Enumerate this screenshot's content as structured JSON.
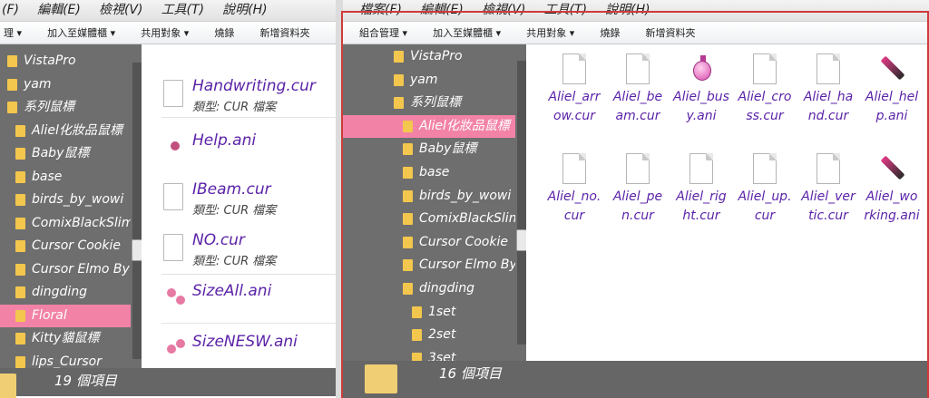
{
  "left": {
    "menu": [
      "(F)",
      "編輯(E)",
      "檢視(V)",
      "工具(T)",
      "說明(H)"
    ],
    "toolbar": [
      "理 ▾",
      "加入至媒體櫃 ▾",
      "共用對象 ▾",
      "燒錄",
      "新增資料夾"
    ],
    "nav": [
      "VistaPro",
      "yam",
      "系列鼠標",
      "Aliel化妝品鼠標",
      "Baby鼠標",
      "base",
      "birds_by_wowi",
      "ComixBlackSlim",
      "Cursor Cookie",
      "Cursor Elmo By",
      "dingding",
      "Floral",
      "Kitty貓鼠標",
      "lips_Cursor"
    ],
    "selected": "Floral",
    "files": [
      {
        "name": "Handwriting.cur",
        "type": "類型: CUR 檔案",
        "icon": "doc-icon"
      },
      {
        "name": "Help.ani",
        "type": "",
        "icon": "flower-cursor-icon"
      },
      {
        "name": "IBeam.cur",
        "type": "類型: CUR 檔案",
        "icon": "doc-icon"
      },
      {
        "name": "NO.cur",
        "type": "類型: CUR 檔案",
        "icon": "doc-icon"
      },
      {
        "name": "SizeAll.ani",
        "type": "",
        "icon": "flower-cursor-icon"
      },
      {
        "name": "SizeNESW.ani",
        "type": "",
        "icon": "flower-cursor-icon"
      }
    ],
    "status": "19 個項目"
  },
  "right": {
    "menu": [
      "檔案(F)",
      "編輯(E)",
      "檢視(V)",
      "工具(T)",
      "說明(H)"
    ],
    "toolbar": [
      "組合管理 ▾",
      "加入至媒體櫃 ▾",
      "共用對象 ▾",
      "燒錄",
      "新增資料夾"
    ],
    "nav": [
      "VistaPro",
      "yam",
      "系列鼠標",
      "Aliel化妝品鼠標",
      "Baby鼠標",
      "base",
      "birds_by_wowi",
      "ComixBlackSlim",
      "Cursor Cookie",
      "Cursor Elmo By",
      "dingding",
      "1set",
      "2set",
      "3set"
    ],
    "selected": "Aliel化妝品鼠標",
    "files": [
      {
        "name": "Aliel_arrow.cur",
        "icon": "doc-icon"
      },
      {
        "name": "Aliel_beam.cur",
        "icon": "doc-icon"
      },
      {
        "name": "Aliel_busy.ani",
        "icon": "perfume-bottle-icon"
      },
      {
        "name": "Aliel_cross.cur",
        "icon": "doc-icon"
      },
      {
        "name": "Aliel_hand.cur",
        "icon": "doc-icon"
      },
      {
        "name": "Aliel_help.ani",
        "icon": "lipstick-icon"
      },
      {
        "name": "Aliel_no.cur",
        "icon": "doc-icon"
      },
      {
        "name": "Aliel_pen.cur",
        "icon": "doc-icon"
      },
      {
        "name": "Aliel_right.cur",
        "icon": "doc-icon"
      },
      {
        "name": "Aliel_up.cur",
        "icon": "doc-icon"
      },
      {
        "name": "Aliel_vertic.cur",
        "icon": "doc-icon"
      },
      {
        "name": "Aliel_working.ani",
        "icon": "lipstick-icon"
      }
    ],
    "status": "16 個項目"
  }
}
